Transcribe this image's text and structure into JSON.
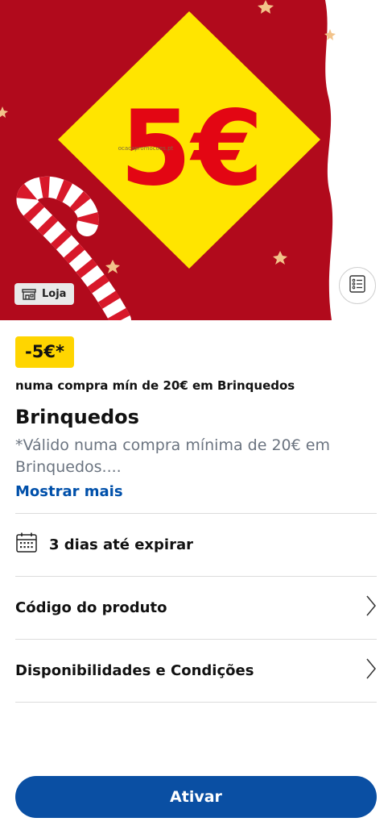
{
  "hero": {
    "price_text": "5€",
    "watermark": "ocacapromocoes.pt",
    "store_tag": "Loja",
    "list_icon": "checklist-icon",
    "colors": {
      "red": "#b10a1c",
      "yellow": "#ffe500",
      "price": "#e30613"
    }
  },
  "offer": {
    "badge": "-5€*",
    "subtitle": "numa compra mín de 20€ em Brinquedos",
    "title": "Brinquedos",
    "description": "*Válido numa compra mínima de 20€ em Brinquedos....",
    "show_more": "Mostrar mais"
  },
  "expiry": {
    "icon": "calendar-icon",
    "text": "3 dias até expirar"
  },
  "rows": [
    {
      "label": "Código do produto",
      "icon": "chevron-right-icon"
    },
    {
      "label": "Disponibilidades e Condições",
      "icon": "chevron-right-icon"
    }
  ],
  "cta": {
    "label": "Ativar",
    "color": "#0a4fa3"
  }
}
